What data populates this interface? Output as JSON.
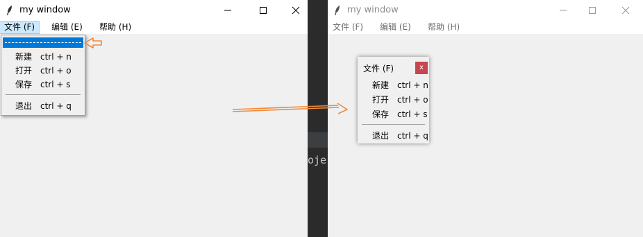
{
  "left_window": {
    "title": "my window",
    "menubar": [
      {
        "label": "文件 (F)",
        "active": true
      },
      {
        "label": "编辑 (E)",
        "active": false
      },
      {
        "label": "帮助 (H)",
        "active": false
      }
    ],
    "dropdown": {
      "items": [
        {
          "label": "新建",
          "accel": "ctrl + n"
        },
        {
          "label": "打开",
          "accel": "ctrl + o"
        },
        {
          "label": "保存",
          "accel": "ctrl + s"
        }
      ],
      "exit": {
        "label": "退出",
        "accel": "ctrl + q"
      }
    }
  },
  "right_window": {
    "title": "my window",
    "menubar": [
      {
        "label": "文件 (F)"
      },
      {
        "label": "编辑 (E)"
      },
      {
        "label": "帮助 (H)"
      }
    ],
    "torn_menu": {
      "title": "文件 (F)",
      "close_glyph": "x",
      "items": [
        {
          "label": "新建",
          "accel": "ctrl + n"
        },
        {
          "label": "打开",
          "accel": "ctrl + o"
        },
        {
          "label": "保存",
          "accel": "ctrl + s"
        }
      ],
      "exit": {
        "label": "退出",
        "accel": "ctrl + q"
      }
    }
  },
  "background_code_fragment": "oje",
  "colors": {
    "highlight": "#0078d7",
    "annotation_arrow": "#f08a3c",
    "close_button": "#c7454e",
    "background": "#f0f0f0"
  },
  "icons": [
    "feather-icon",
    "minimize-icon",
    "maximize-icon",
    "close-icon"
  ]
}
